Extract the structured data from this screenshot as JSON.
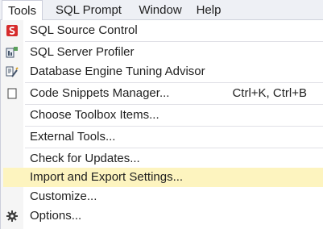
{
  "menubar": {
    "items": [
      {
        "label": "Tools"
      },
      {
        "label": "SQL Prompt"
      },
      {
        "label": "Window"
      },
      {
        "label": "Help"
      }
    ]
  },
  "menu": {
    "items": [
      {
        "label": "SQL Source Control",
        "icon": "sql-source-control-icon"
      },
      {
        "label": "SQL Server Profiler",
        "icon": "profiler-icon"
      },
      {
        "label": "Database Engine Tuning Advisor",
        "icon": "tuning-advisor-icon"
      },
      {
        "label": "Code Snippets Manager...",
        "shortcut": "Ctrl+K, Ctrl+B",
        "icon": "snippets-icon"
      },
      {
        "label": "Choose Toolbox Items..."
      },
      {
        "label": "External Tools..."
      },
      {
        "label": "Check for Updates..."
      },
      {
        "label": "Import and Export Settings..."
      },
      {
        "label": "Customize..."
      },
      {
        "label": "Options...",
        "icon": "gear-icon"
      }
    ],
    "highlight_color": "#fdf4bf",
    "accent_red": "#d62b2b"
  }
}
